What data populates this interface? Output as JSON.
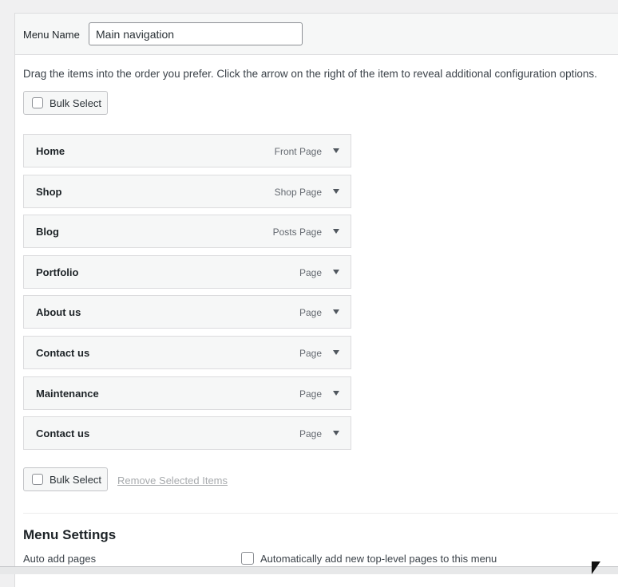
{
  "menu_name": {
    "label": "Menu Name",
    "value": "Main navigation"
  },
  "instructions": "Drag the items into the order you prefer. Click the arrow on the right of the item to reveal additional configuration options.",
  "bulk_select": {
    "label": "Bulk Select",
    "checked": false
  },
  "menu_items": [
    {
      "title": "Home",
      "type": "Front Page"
    },
    {
      "title": "Shop",
      "type": "Shop Page"
    },
    {
      "title": "Blog",
      "type": "Posts Page"
    },
    {
      "title": "Portfolio",
      "type": "Page"
    },
    {
      "title": "About us",
      "type": "Page"
    },
    {
      "title": "Contact us",
      "type": "Page"
    },
    {
      "title": "Maintenance",
      "type": "Page"
    },
    {
      "title": "Contact us",
      "type": "Page"
    }
  ],
  "remove_selected": "Remove Selected Items",
  "menu_settings": {
    "heading": "Menu Settings",
    "auto_add_label": "Auto add pages",
    "auto_add_option": "Automatically add new top-level pages to this menu",
    "auto_add_checked": false
  },
  "icons": {
    "item_toggle": "triangle-down-icon",
    "cursor": "mouse-pointer-icon"
  },
  "colors": {
    "panel_bg": "#ffffff",
    "item_bg": "#f6f7f7",
    "border": "#dcdcde",
    "muted_link": "#a7aaad"
  }
}
